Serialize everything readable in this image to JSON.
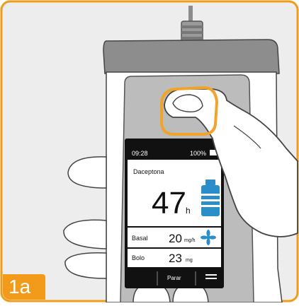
{
  "illustration": {
    "step_label": "1a",
    "border_color": "#f29b1a",
    "device": {
      "status_bar": {
        "time": "09:28",
        "battery_percent": "100%",
        "battery_icon": "battery-icon"
      },
      "drug_name": "Daceptona",
      "remaining_value": "47",
      "remaining_unit": "h",
      "reservoir_icon": "medication-vial-icon",
      "rows": [
        {
          "label": "Basal",
          "value": "20",
          "unit": "mg/h",
          "icon": "fan-icon"
        },
        {
          "label": "Bolo",
          "value": "23",
          "unit": "mg"
        }
      ],
      "softkeys": {
        "center_label": "Parar",
        "menu_icon": "menu-icon"
      }
    }
  }
}
